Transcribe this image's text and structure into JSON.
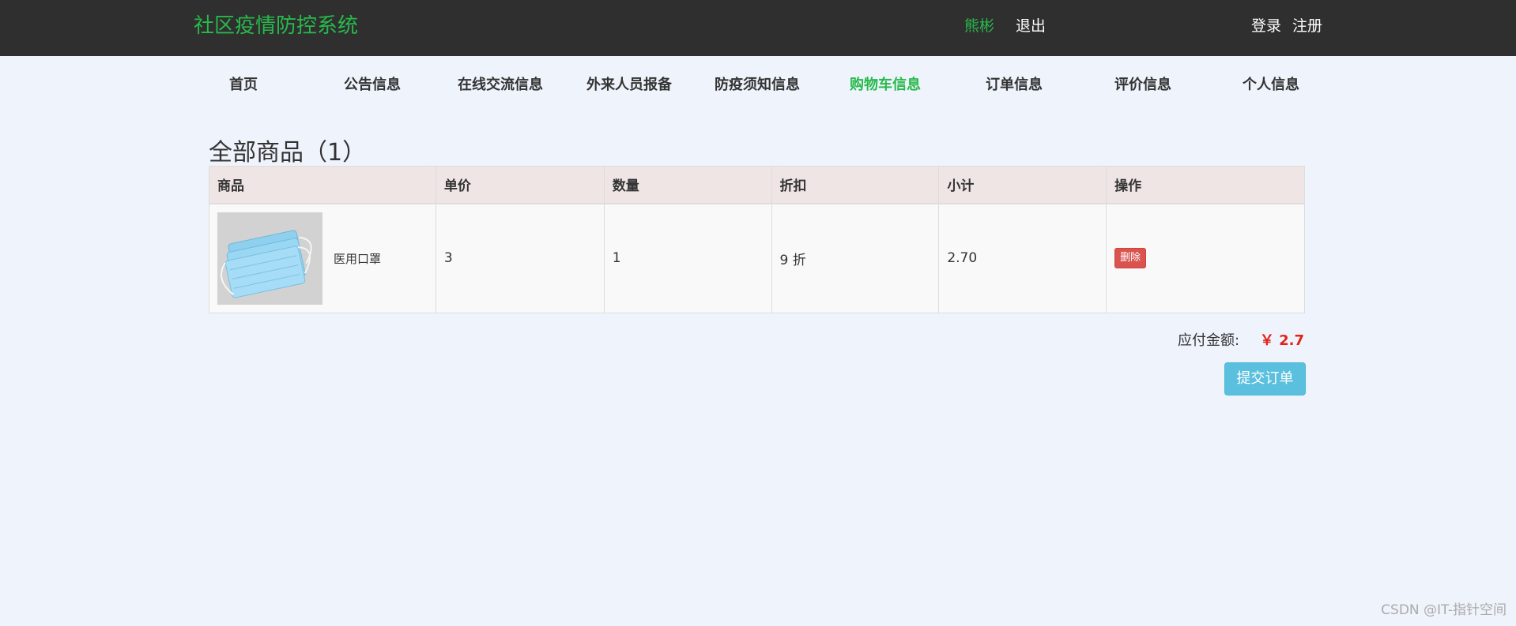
{
  "header": {
    "brand": "社区疫情防控系统",
    "user_name": "熊彬",
    "logout": "退出",
    "login": "登录",
    "register": "注册"
  },
  "nav": {
    "items": [
      {
        "label": "首页"
      },
      {
        "label": "公告信息"
      },
      {
        "label": "在线交流信息"
      },
      {
        "label": "外来人员报备"
      },
      {
        "label": "防疫须知信息"
      },
      {
        "label": "购物车信息"
      },
      {
        "label": "订单信息"
      },
      {
        "label": "评价信息"
      },
      {
        "label": "个人信息"
      }
    ],
    "active_index": 5
  },
  "cart": {
    "title": "全部商品（1）",
    "columns": [
      "商品",
      "单价",
      "数量",
      "折扣",
      "小计",
      "操作"
    ],
    "rows": [
      {
        "product": "医用口罩",
        "price": "3",
        "quantity": "1",
        "discount": "9 折",
        "subtotal": "2.70",
        "action": "删除"
      }
    ],
    "total_label": "应付金额:",
    "total_value": "￥ 2.7",
    "submit_label": "提交订单"
  },
  "watermark": "CSDN @IT-指针空间",
  "colors": {
    "brand_green": "#27ba4b",
    "topbar": "#2f2f2f",
    "page_bg": "#eff4fc",
    "danger": "#d9534f",
    "info": "#5bc0de",
    "total_red": "#e2231a"
  }
}
